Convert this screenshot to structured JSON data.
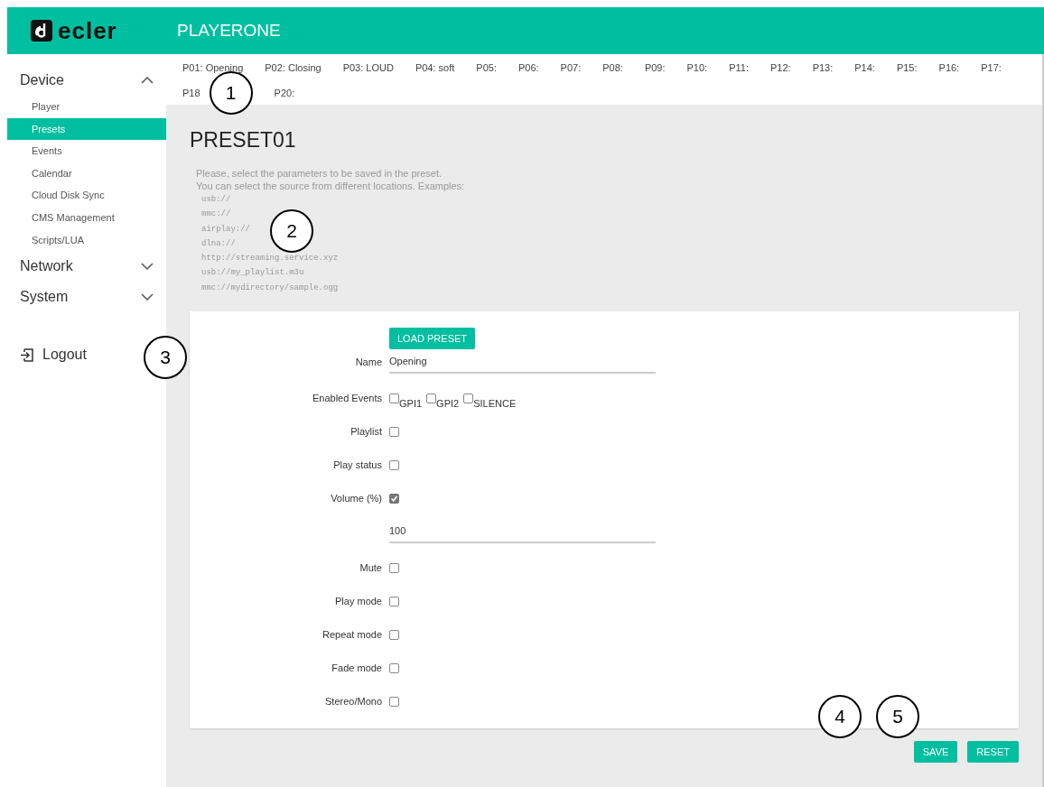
{
  "header": {
    "logo": "ecler",
    "title": "PLAYERONE"
  },
  "sidebar": {
    "groups": [
      {
        "label": "Device",
        "expanded": true,
        "items": [
          {
            "label": "Player",
            "selected": false
          },
          {
            "label": "Presets",
            "selected": true
          },
          {
            "label": "Events",
            "selected": false
          },
          {
            "label": "Calendar",
            "selected": false
          },
          {
            "label": "Cloud Disk Sync",
            "selected": false
          },
          {
            "label": "CMS Management",
            "selected": false
          },
          {
            "label": "Scripts/LUA",
            "selected": false
          }
        ]
      },
      {
        "label": "Network",
        "expanded": false
      },
      {
        "label": "System",
        "expanded": false
      }
    ],
    "logout": "Logout"
  },
  "tabs": [
    {
      "kind": "tab",
      "label": "P01: Opening"
    },
    {
      "kind": "tab",
      "label": "P02: Closing"
    },
    {
      "kind": "tab",
      "label": "P03: LOUD"
    },
    {
      "kind": "tab",
      "label": "P04: soft"
    },
    {
      "kind": "tab",
      "label": "P05:"
    },
    {
      "kind": "tab",
      "label": "P06:"
    },
    {
      "kind": "tab",
      "label": "P07:"
    },
    {
      "kind": "tab",
      "label": "P08:"
    },
    {
      "kind": "tab",
      "label": "P09:"
    },
    {
      "kind": "tab",
      "label": "P10:"
    },
    {
      "kind": "tab",
      "label": "P11:"
    },
    {
      "kind": "tab",
      "label": "P12:"
    },
    {
      "kind": "tab",
      "label": "P13:"
    },
    {
      "kind": "tab",
      "label": "P14:"
    },
    {
      "kind": "tab",
      "label": "P15:"
    },
    {
      "kind": "tab",
      "label": "P16:"
    },
    {
      "kind": "tab",
      "label": "P17:"
    },
    {
      "kind": "tab",
      "label": "P18"
    },
    {
      "kind": "callout",
      "label": "1"
    },
    {
      "kind": "tab",
      "label": "P20:"
    }
  ],
  "page": {
    "title": "PRESET01",
    "description": [
      "Please, select the parameters to be saved in the preset.",
      "You can select the source from different locations. Examples:"
    ],
    "examples": [
      "usb://",
      "mmc://",
      "airplay://",
      "dlna://",
      "http://streaming.service.xyz",
      "usb://my_playlist.m3u",
      "mmc://mydirectory/sample.ogg"
    ]
  },
  "form": [
    {
      "kind": "button",
      "label": "LOAD PRESET"
    },
    {
      "kind": "text",
      "label": "Name",
      "value": "Opening"
    },
    {
      "kind": "checks",
      "label": "Enabled Events",
      "options": [
        {
          "label": "GPI1",
          "checked": false
        },
        {
          "label": "GPI2",
          "checked": false
        },
        {
          "label": "SILENCE",
          "checked": false
        }
      ]
    },
    {
      "kind": "checkbox",
      "label": "Playlist",
      "checked": false
    },
    {
      "kind": "checkbox",
      "label": "Play status",
      "checked": false
    },
    {
      "kind": "checkbox",
      "label": "Volume (%)",
      "checked": true
    },
    {
      "kind": "text",
      "value": "100"
    },
    {
      "kind": "checkbox",
      "label": "Mute",
      "checked": false
    },
    {
      "kind": "checkbox",
      "label": "Play mode",
      "checked": false
    },
    {
      "kind": "checkbox",
      "label": "Repeat mode",
      "checked": false
    },
    {
      "kind": "checkbox",
      "label": "Fade mode",
      "checked": false
    },
    {
      "kind": "checkbox",
      "label": "Stereo/Mono",
      "checked": false
    }
  ],
  "actions": [
    "SAVE",
    "RESET"
  ],
  "callouts": [
    {
      "label": "2"
    },
    {
      "label": "3"
    },
    {
      "label": "4"
    },
    {
      "label": "5"
    }
  ]
}
